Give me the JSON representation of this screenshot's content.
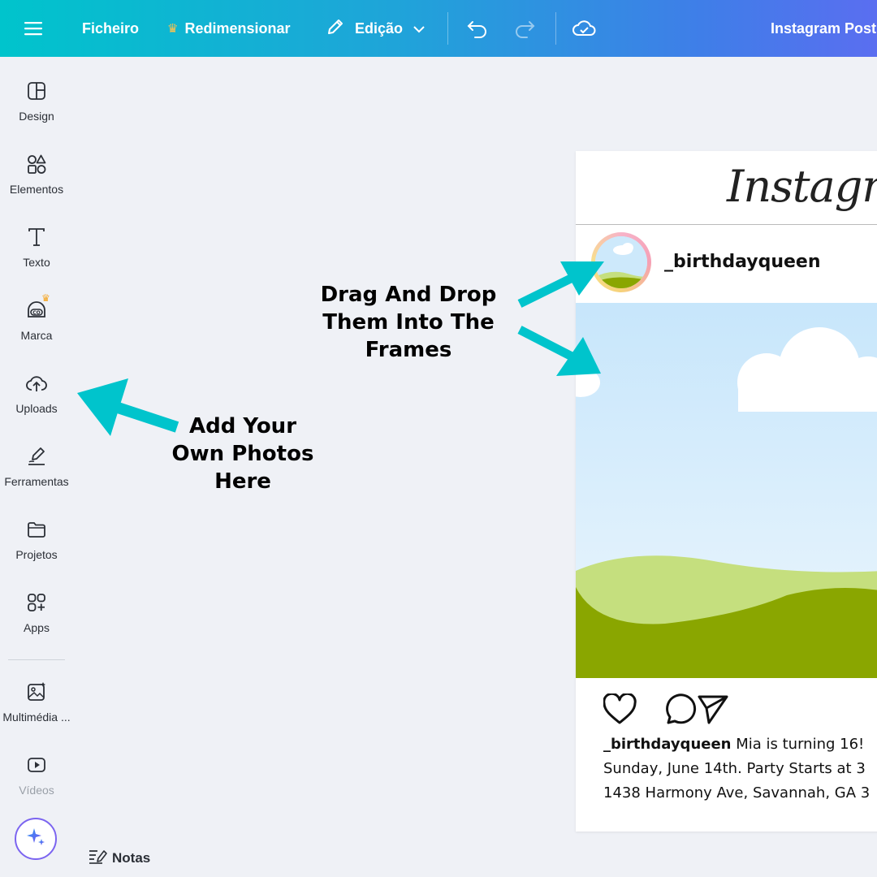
{
  "topbar": {
    "menu_icon": "hamburger-icon",
    "file_label": "Ficheiro",
    "resize_label": "Redimensionar",
    "resize_icon": "crown-icon",
    "edit_label": "Edição",
    "edit_icon": "pencil-icon",
    "undo_icon": "undo-icon",
    "redo_icon": "redo-icon",
    "save_status_icon": "cloud-check-icon",
    "doc_title": "Instagram Post"
  },
  "sidebar": {
    "items": [
      {
        "label": "Design",
        "icon": "layout-icon"
      },
      {
        "label": "Elementos",
        "icon": "shapes-icon"
      },
      {
        "label": "Texto",
        "icon": "text-icon"
      },
      {
        "label": "Marca",
        "icon": "brand-icon"
      },
      {
        "label": "Uploads",
        "icon": "cloud-upload-icon"
      },
      {
        "label": "Ferramentas",
        "icon": "draw-icon"
      },
      {
        "label": "Projetos",
        "icon": "folder-icon"
      },
      {
        "label": "Apps",
        "icon": "apps-icon"
      },
      {
        "label": "Multimédia ...",
        "icon": "magic-media-icon"
      },
      {
        "label": "Vídeos",
        "icon": "video-icon"
      }
    ],
    "magic_button_icon": "sparkle-icon",
    "notes_label": "Notas"
  },
  "annotations": {
    "drag_drop": [
      "Drag And Drop",
      "Them Into The",
      "Frames"
    ],
    "add_photos": [
      "Add Your",
      "Own Photos",
      "Here"
    ],
    "arrow_color": "#00c4cc"
  },
  "post": {
    "logo_text": "Instagram",
    "username": "_birthdayqueen",
    "caption_user": "_birthdayqueen",
    "caption_lines": [
      "Mia is turning 16! ",
      "Sunday, June 14th. Party Starts at 3",
      "1438 Harmony Ave, Savannah, GA 3"
    ],
    "action_icons": [
      "heart-icon",
      "comment-icon",
      "share-icon"
    ]
  },
  "colors": {
    "brand_teal": "#00c4cc",
    "brand_blue": "#5a6ef0",
    "sky": "#cde9fb",
    "hill_light": "#c5df7e",
    "hill_dark": "#8aa600"
  }
}
